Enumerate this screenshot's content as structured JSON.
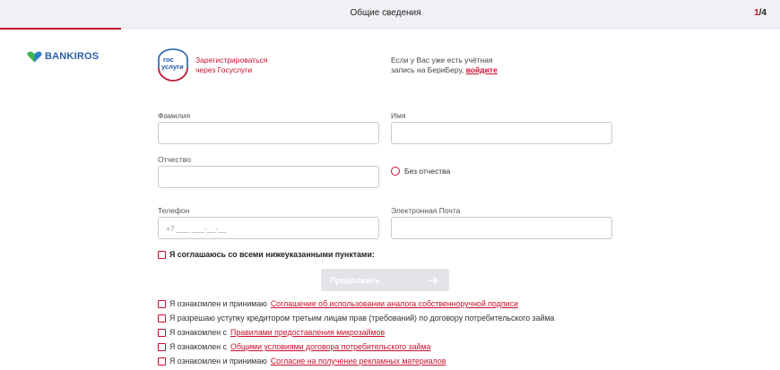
{
  "header": {
    "title": "Общие сведения",
    "step_current": "1",
    "step_total": "/4",
    "progress": 0.155
  },
  "brand": {
    "name": "BANKIROS"
  },
  "gosuslugi": {
    "logo_line1": "гос",
    "logo_line2": "услуги",
    "link_line1": "Зарегистрироваться",
    "link_line2": "через Госуслуги"
  },
  "existing_account": {
    "text_line1": "Если у Вас уже есть учётная",
    "text_line2": "запись на БериБеру,",
    "login_link": "войдите"
  },
  "form": {
    "last_name_label": "Фамилия",
    "first_name_label": "Имя",
    "middle_name_label": "Отчество",
    "no_middle_name_label": "Без отчества",
    "phone_label": "Телефон",
    "phone_placeholder": "+7 ___ ___-__-__",
    "email_label": "Электронная Почта"
  },
  "agree_all": "Я соглашаюсь со всеми нижеуказанными пунктами:",
  "continue_label": "Продолжить",
  "agreements": [
    {
      "text": "Я ознакомлен и принимаю",
      "link": "Соглашение об использовании аналога собственноручной подписи"
    },
    {
      "text": "Я разрешаю уступку кредитором третьим лицам прав (требований) по договору потребительского займа",
      "link": ""
    },
    {
      "text": "Я ознакомлен с",
      "link": "Правилами предоставления микрозаймов"
    },
    {
      "text": "Я ознакомлен с",
      "link": "Общими условиями договора потребительского займа"
    },
    {
      "text": "Я ознакомлен и принимаю",
      "link": "Согласие на получение рекламных материалов"
    }
  ],
  "colors": {
    "accent": "#c8102e",
    "brand_blue": "#2a5fa8",
    "brand_green": "#3fb34f"
  },
  "icons": {
    "logo": "bankiros-heart-icon",
    "continue": "arrow-right-icon"
  }
}
